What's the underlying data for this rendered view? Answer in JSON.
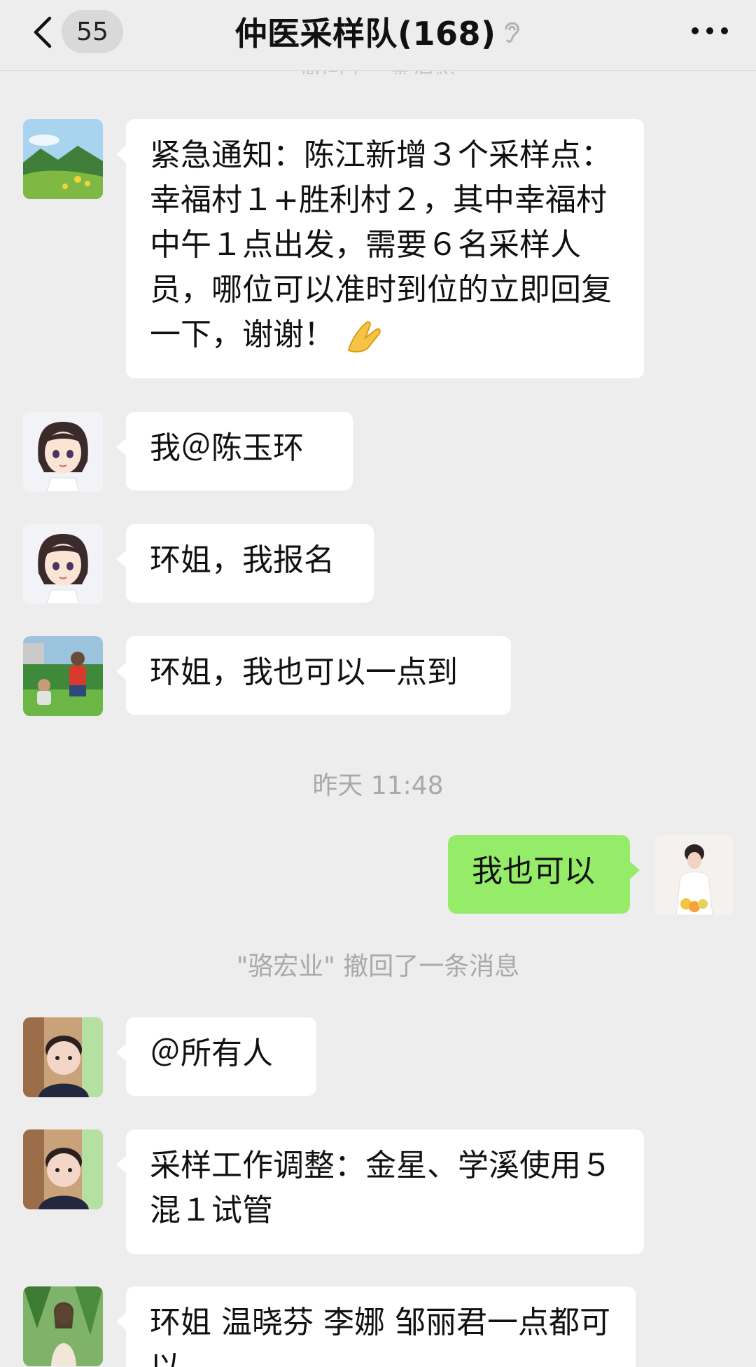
{
  "header": {
    "unread_count": "55",
    "title": "仲医采样队(168)"
  },
  "top_partial_text": "撤回了一条消息",
  "messages": [
    {
      "text": "紧急通知：陈江新增３个采样点：幸福村１+胜利村２，其中幸福村中午１点出发，需要６名采样人员，哪位可以准时到位的立即回复一下，谢谢！"
    },
    {
      "text": "我＠陈玉环"
    },
    {
      "text": "环姐，我报名"
    },
    {
      "text": "环姐，我也可以一点到"
    },
    {
      "text": "我也可以"
    },
    {
      "text": "＠所有人"
    },
    {
      "text": "采样工作调整：金星、学溪使用５混１试管"
    },
    {
      "text": "环姐 温晓芬 李娜 邹丽君一点都可以"
    }
  ],
  "time_divider": "昨天 11:48",
  "recall_notice": "\"骆宏业\" 撤回了一条消息",
  "colors": {
    "background": "#ededed",
    "own_bubble": "#95ec69",
    "other_bubble": "#ffffff"
  }
}
